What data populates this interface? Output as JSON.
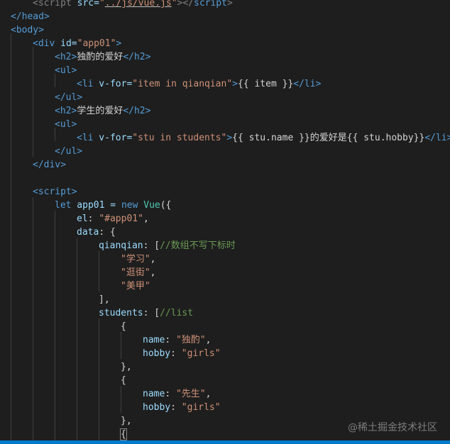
{
  "code": {
    "l1_tag_open": "<script",
    "l1_attr": " src=",
    "l1_str_q1": "\"",
    "l1_str_path": "../js/vue.js",
    "l1_str_q2": "\"",
    "l1_close": "></",
    "l1_tag_close": "script",
    "l1_end": ">",
    "l2": "</head>",
    "l3": "<body>",
    "l4_open": "<div",
    "l4_attr": " id=",
    "l4_str": "\"app01\"",
    "l4_end": ">",
    "l5_open": "<h2>",
    "l5_text": "独酌的爱好",
    "l5_close": "</h2>",
    "l6": "<ul>",
    "l7_open": "<li",
    "l7_attr": " v-for=",
    "l7_str": "\"item in qianqian\"",
    "l7_gt": ">",
    "l7_text": "{{ item }}",
    "l7_close": "</li>",
    "l8": "</ul>",
    "l9_open": "<h2>",
    "l9_text": "学生的爱好",
    "l9_close": "</h2>",
    "l10": "<ul>",
    "l11_open": "<li",
    "l11_attr": " v-for=",
    "l11_str": "\"stu in students\"",
    "l11_gt": ">",
    "l11_text": "{{ stu.name }}的爱好是{{ stu.hobby}}",
    "l11_close": "</li>",
    "l12": "</ul>",
    "l13": "</div>",
    "l15": "<script>",
    "l16_kw": "let",
    "l16_a": " app01 = ",
    "l16_new": "new",
    "l16_sp": " ",
    "l16_cls": "Vue",
    "l16_b": "({",
    "l17_key": "el",
    "l17_colon": ": ",
    "l17_str": "\"#app01\"",
    "l17_end": ",",
    "l18_key": "data",
    "l18_end": ": {",
    "l19_key": "qianqian",
    "l19_mid": ": [",
    "l19_cmt": "//数组不写下标时",
    "l20_str": "\"学习\"",
    "l20_end": ",",
    "l21_str": "\"逛街\"",
    "l21_end": ",",
    "l22_str": "\"美甲\"",
    "l23": "],",
    "l24_key": "students",
    "l24_mid": ": [",
    "l24_cmt": "//list",
    "l25": "{",
    "l26_key": "name",
    "l26_colon": ": ",
    "l26_str": "\"独酌\"",
    "l26_end": ",",
    "l27_key": "hobby",
    "l27_colon": ": ",
    "l27_str": "\"girls\"",
    "l28": "},",
    "l29": "{",
    "l30_key": "name",
    "l30_colon": ": ",
    "l30_str": "\"先生\"",
    "l30_end": ",",
    "l31_key": "hobby",
    "l31_colon": ": ",
    "l31_str": "\"girls\"",
    "l32": "},",
    "l33": "{"
  },
  "watermark": "@稀土掘金技术社区",
  "colors": {
    "background": "#1e1e1e",
    "tag": "#569cd6",
    "attribute": "#9cdcfe",
    "string": "#ce9178",
    "comment": "#6a9955",
    "class": "#4ec9b0",
    "statusbar": "#007acc"
  }
}
